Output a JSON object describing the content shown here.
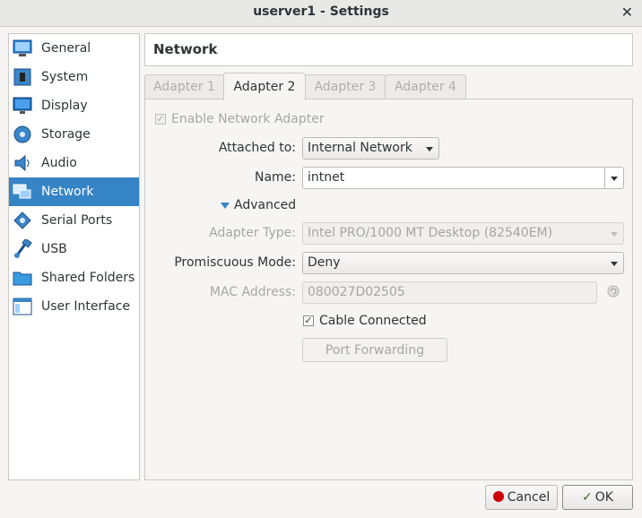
{
  "window": {
    "title": "userver1 - Settings",
    "close_glyph": "✕"
  },
  "sidebar": {
    "items": [
      {
        "label": "General",
        "icon": "general-icon"
      },
      {
        "label": "System",
        "icon": "system-icon"
      },
      {
        "label": "Display",
        "icon": "display-icon"
      },
      {
        "label": "Storage",
        "icon": "storage-icon"
      },
      {
        "label": "Audio",
        "icon": "audio-icon"
      },
      {
        "label": "Network",
        "icon": "network-icon",
        "selected": true
      },
      {
        "label": "Serial Ports",
        "icon": "serial-ports-icon"
      },
      {
        "label": "USB",
        "icon": "usb-icon"
      },
      {
        "label": "Shared Folders",
        "icon": "shared-folders-icon"
      },
      {
        "label": "User Interface",
        "icon": "user-interface-icon"
      }
    ]
  },
  "page": {
    "title": "Network"
  },
  "tabs": [
    {
      "label": "Adapter 1",
      "active": false
    },
    {
      "label": "Adapter 2",
      "active": true
    },
    {
      "label": "Adapter 3",
      "active": false
    },
    {
      "label": "Adapter 4",
      "active": false
    }
  ],
  "adapter": {
    "enable_label": "Enable Network Adapter",
    "enable_checked": true,
    "attached_label": "Attached to:",
    "attached_value": "Internal Network",
    "name_label": "Name:",
    "name_value": "intnet",
    "advanced_label": "Advanced",
    "adapter_type_label": "Adapter Type:",
    "adapter_type_value": "Intel PRO/1000 MT Desktop (82540EM)",
    "promiscuous_label": "Promiscuous Mode:",
    "promiscuous_value": "Deny",
    "mac_label": "MAC Address:",
    "mac_value": "080027D02505",
    "cable_label": "Cable Connected",
    "cable_checked": true,
    "check_glyph": "✓",
    "port_forwarding_label": "Port Forwarding"
  },
  "footer": {
    "cancel_label": "Cancel",
    "ok_label": "OK"
  },
  "colors": {
    "accent": "#3584c5",
    "cancel_icon": "#cc0000"
  }
}
